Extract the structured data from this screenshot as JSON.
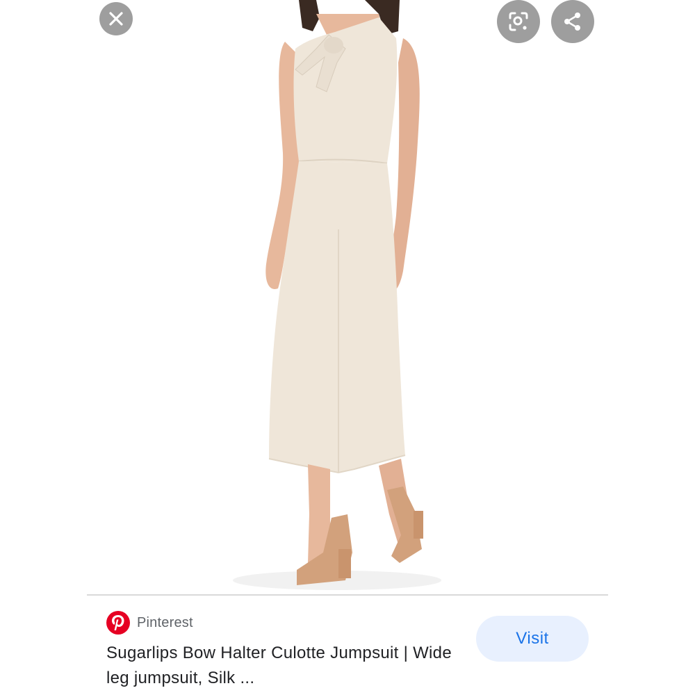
{
  "viewer": {
    "image_alt": "Woman wearing cream bow halter culotte jumpsuit with tan heeled sandals",
    "close_icon": "close-icon",
    "lens_icon": "lens-search-icon",
    "share_icon": "share-icon"
  },
  "result": {
    "source_name": "Pinterest",
    "source_icon": "pinterest-logo",
    "title": "Sugarlips Bow Halter Culotte Jumpsuit | Wide leg jumpsuit, Silk ...",
    "visit_label": "Visit"
  },
  "colors": {
    "accent": "#1a73e8",
    "visit_bg": "#e8f0fe",
    "pinterest_red": "#e60023",
    "garment": "#efe6d9"
  }
}
